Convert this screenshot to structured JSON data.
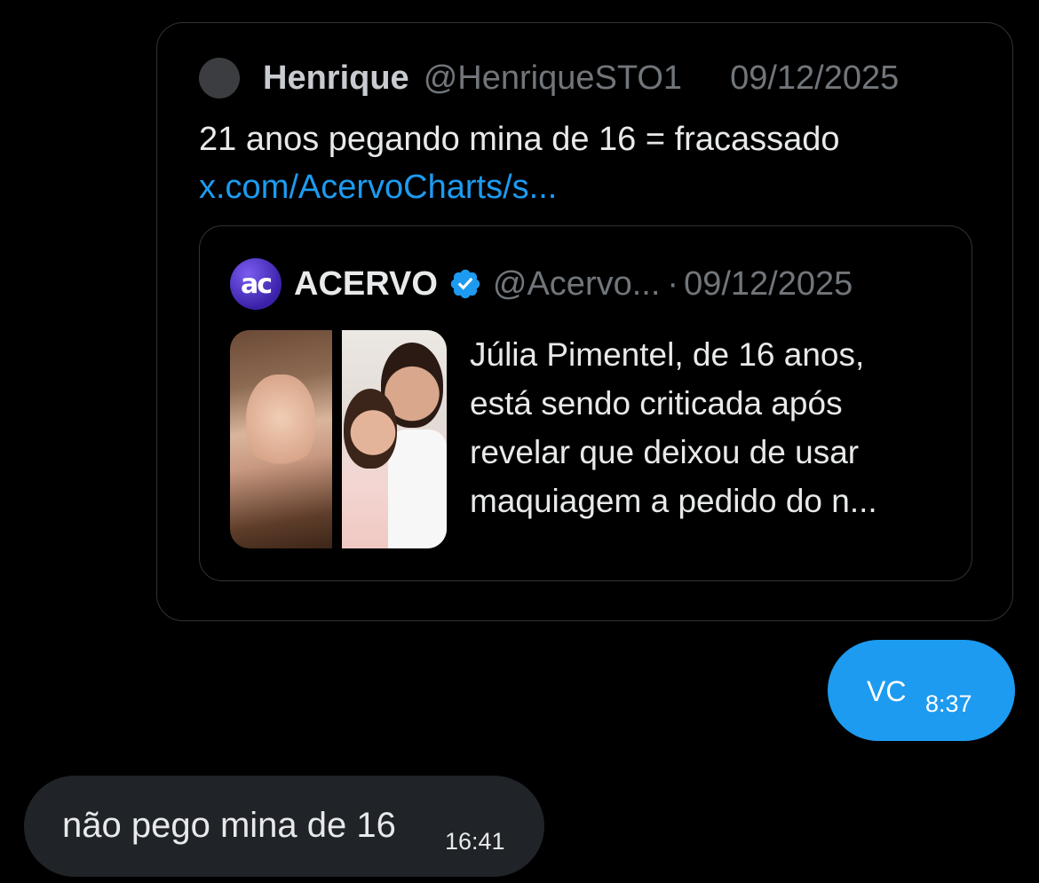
{
  "shared_tweet": {
    "author_name": "Henrique",
    "author_handle": "@HenriqueSTO1",
    "date": "09/12/2025",
    "text": "21 anos pegando mina de 16 = fracassado",
    "link": "x.com/AcervoCharts/s...",
    "quoted_tweet": {
      "logo_text": "ac",
      "author_name": "ACERVO",
      "author_handle": "@Acervo...",
      "separator": "·",
      "date": "09/12/2025",
      "text_lines": [
        "Júlia Pimentel, de 16 anos,",
        "está sendo criticada após",
        "revelar que deixou de usar",
        "maquiagem a pedido do n..."
      ]
    }
  },
  "messages": [
    {
      "direction": "sent",
      "text": "VC",
      "time": "8:37"
    },
    {
      "direction": "received",
      "text": "não pego mina de 16",
      "time": "16:41"
    }
  ],
  "colors": {
    "background": "#000000",
    "sent_bubble": "#1d9bf0",
    "received_bubble": "#202327",
    "link": "#1d9bf0",
    "muted_text": "#71767b",
    "verified_badge": "#1d9bf0"
  }
}
